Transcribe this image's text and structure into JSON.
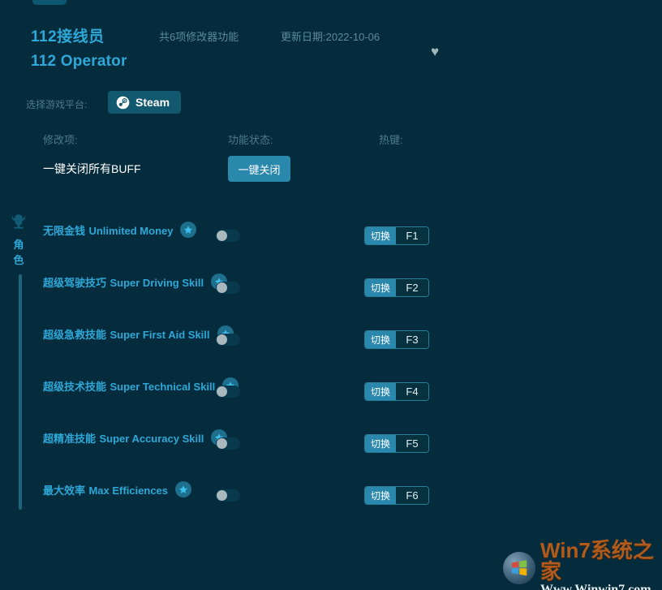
{
  "app": {
    "tab_stub": ""
  },
  "header": {
    "title_cn": "112接线员",
    "title_en": "112 Operator",
    "feature_count": "共6项修改器功能",
    "update_date": "更新日期:2022-10-06",
    "favorite_icon": "heart-icon",
    "accent_color": "#2ea8d8"
  },
  "platform": {
    "label": "选择游戏平台:",
    "selected": "Steam",
    "icon": "steam-icon"
  },
  "columns": {
    "modifier": "修改项:",
    "status": "功能状态:",
    "hotkey": "热键:"
  },
  "master": {
    "label": "一键关闭所有BUFF",
    "button": "一键关闭"
  },
  "category": {
    "icon": "helmet-icon",
    "label": "角色"
  },
  "rows": [
    {
      "name_cn": "无限金钱",
      "name_en": "Unlimited Money",
      "badge": "star-icon",
      "toggle_state": "off",
      "hotkey_action": "切换",
      "hotkey_key": "F1"
    },
    {
      "name_cn": "超级驾驶技巧",
      "name_en": "Super Driving Skill",
      "badge": "star-icon",
      "toggle_state": "off",
      "hotkey_action": "切换",
      "hotkey_key": "F2"
    },
    {
      "name_cn": "超级急救技能",
      "name_en": "Super First Aid Skill",
      "badge": "star-icon",
      "toggle_state": "off",
      "hotkey_action": "切换",
      "hotkey_key": "F3"
    },
    {
      "name_cn": "超级技术技能",
      "name_en": "Super Technical Skill",
      "badge": "star-icon",
      "toggle_state": "off",
      "hotkey_action": "切换",
      "hotkey_key": "F4"
    },
    {
      "name_cn": "超精准技能",
      "name_en": "Super Accuracy Skill",
      "badge": "star-icon",
      "toggle_state": "off",
      "hotkey_action": "切换",
      "hotkey_key": "F5"
    },
    {
      "name_cn": "最大效率",
      "name_en": "Max Efficiences",
      "badge": "star-icon",
      "toggle_state": "off",
      "hotkey_action": "切换",
      "hotkey_key": "F6"
    }
  ],
  "watermark": {
    "main": "Win7系统之家",
    "sub": "Www.Winwin7.com",
    "icon": "windows-logo-icon"
  }
}
